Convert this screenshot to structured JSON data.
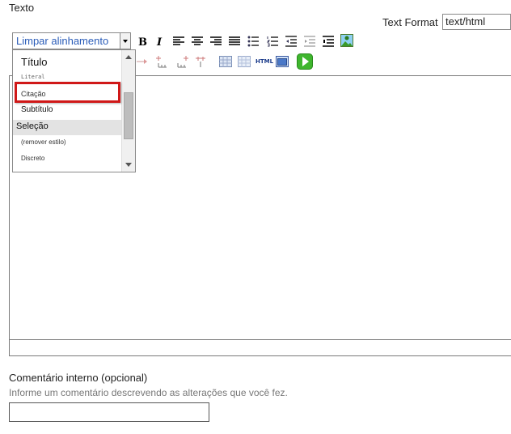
{
  "field": {
    "label": "Texto"
  },
  "text_format": {
    "label": "Text Format",
    "value": "text/html"
  },
  "toolbar": {
    "style_select_value": "Limpar alinhamento",
    "html_label": "HTML"
  },
  "style_dropdown": {
    "items": [
      {
        "label": "Título"
      },
      {
        "label": "Literal"
      },
      {
        "label": "Citação"
      },
      {
        "label": "Subtítulo"
      },
      {
        "label": "Seleção"
      },
      {
        "label": "(remover estilo)"
      },
      {
        "label": "Discreto"
      }
    ],
    "highlighted_item": "Citação",
    "hover_item": "Seleção"
  },
  "comment": {
    "label": "Comentário interno (opcional)",
    "hint": "Informe um comentário descrevendo as alterações que você fez.",
    "value": ""
  },
  "colors": {
    "select_text": "#2a5cb8",
    "highlight_border": "#d01818",
    "hover_bg": "#e3e3e3",
    "play_green": "#3fb62e"
  }
}
